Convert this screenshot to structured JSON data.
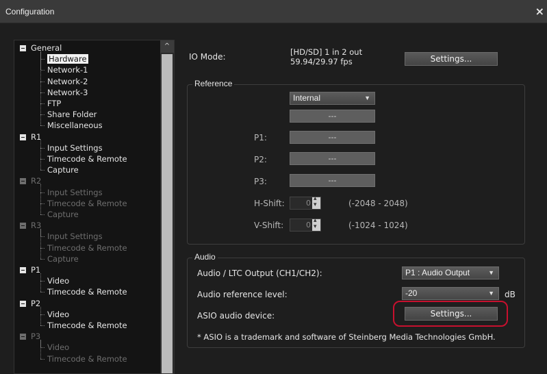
{
  "window": {
    "title": "Configuration",
    "close_glyph": "×"
  },
  "tree": {
    "nodes": [
      {
        "label": "General",
        "level": 0,
        "dim": false
      },
      {
        "label": "Hardware",
        "level": 1,
        "dim": false,
        "selected": true
      },
      {
        "label": "Network-1",
        "level": 1,
        "dim": false
      },
      {
        "label": "Network-2",
        "level": 1,
        "dim": false
      },
      {
        "label": "Network-3",
        "level": 1,
        "dim": false
      },
      {
        "label": "FTP",
        "level": 1,
        "dim": false
      },
      {
        "label": "Share Folder",
        "level": 1,
        "dim": false
      },
      {
        "label": "Miscellaneous",
        "level": 1,
        "dim": false
      },
      {
        "label": "R1",
        "level": 0,
        "dim": false
      },
      {
        "label": "Input Settings",
        "level": 1,
        "dim": false
      },
      {
        "label": "Timecode & Remote",
        "level": 1,
        "dim": false
      },
      {
        "label": "Capture",
        "level": 1,
        "dim": false
      },
      {
        "label": "R2",
        "level": 0,
        "dim": true
      },
      {
        "label": "Input Settings",
        "level": 1,
        "dim": true
      },
      {
        "label": "Timecode & Remote",
        "level": 1,
        "dim": true
      },
      {
        "label": "Capture",
        "level": 1,
        "dim": true
      },
      {
        "label": "R3",
        "level": 0,
        "dim": true
      },
      {
        "label": "Input Settings",
        "level": 1,
        "dim": true
      },
      {
        "label": "Timecode & Remote",
        "level": 1,
        "dim": true
      },
      {
        "label": "Capture",
        "level": 1,
        "dim": true
      },
      {
        "label": "P1",
        "level": 0,
        "dim": false
      },
      {
        "label": "Video",
        "level": 1,
        "dim": false
      },
      {
        "label": "Timecode & Remote",
        "level": 1,
        "dim": false
      },
      {
        "label": "P2",
        "level": 0,
        "dim": false
      },
      {
        "label": "Video",
        "level": 1,
        "dim": false
      },
      {
        "label": "Timecode & Remote",
        "level": 1,
        "dim": false
      },
      {
        "label": "P3",
        "level": 0,
        "dim": true
      },
      {
        "label": "Video",
        "level": 1,
        "dim": true
      },
      {
        "label": "Timecode & Remote",
        "level": 1,
        "dim": true
      }
    ],
    "scroll_up_glyph": "^"
  },
  "io_mode": {
    "label": "IO Mode:",
    "value_line1": "[HD/SD] 1 in 2 out",
    "value_line2": "59.94/29.97 fps",
    "settings_label": "Settings..."
  },
  "reference": {
    "group_title": "Reference",
    "source_select": "Internal",
    "source_field": "---",
    "p1_label": "P1:",
    "p1_value": "---",
    "p2_label": "P2:",
    "p2_value": "---",
    "p3_label": "P3:",
    "p3_value": "---",
    "hshift_label": "H-Shift:",
    "hshift_value": "0",
    "hshift_range": "(-2048 - 2048)",
    "vshift_label": "V-Shift:",
    "vshift_value": "0",
    "vshift_range": "(-1024 - 1024)"
  },
  "audio": {
    "group_title": "Audio",
    "ltc_label": "Audio / LTC Output (CH1/CH2):",
    "ltc_select": "P1 : Audio Output",
    "ref_level_label": "Audio reference level:",
    "ref_level_select": "-20",
    "ref_level_unit": "dB",
    "asio_label": "ASIO audio device:",
    "asio_settings_label": "Settings...",
    "trademark_note": "* ASIO is a trademark and software of Steinberg Media Technologies GmbH."
  },
  "colors": {
    "highlight_ring": "#c8102e",
    "tree_selected_bg": "#f2f2f2"
  }
}
